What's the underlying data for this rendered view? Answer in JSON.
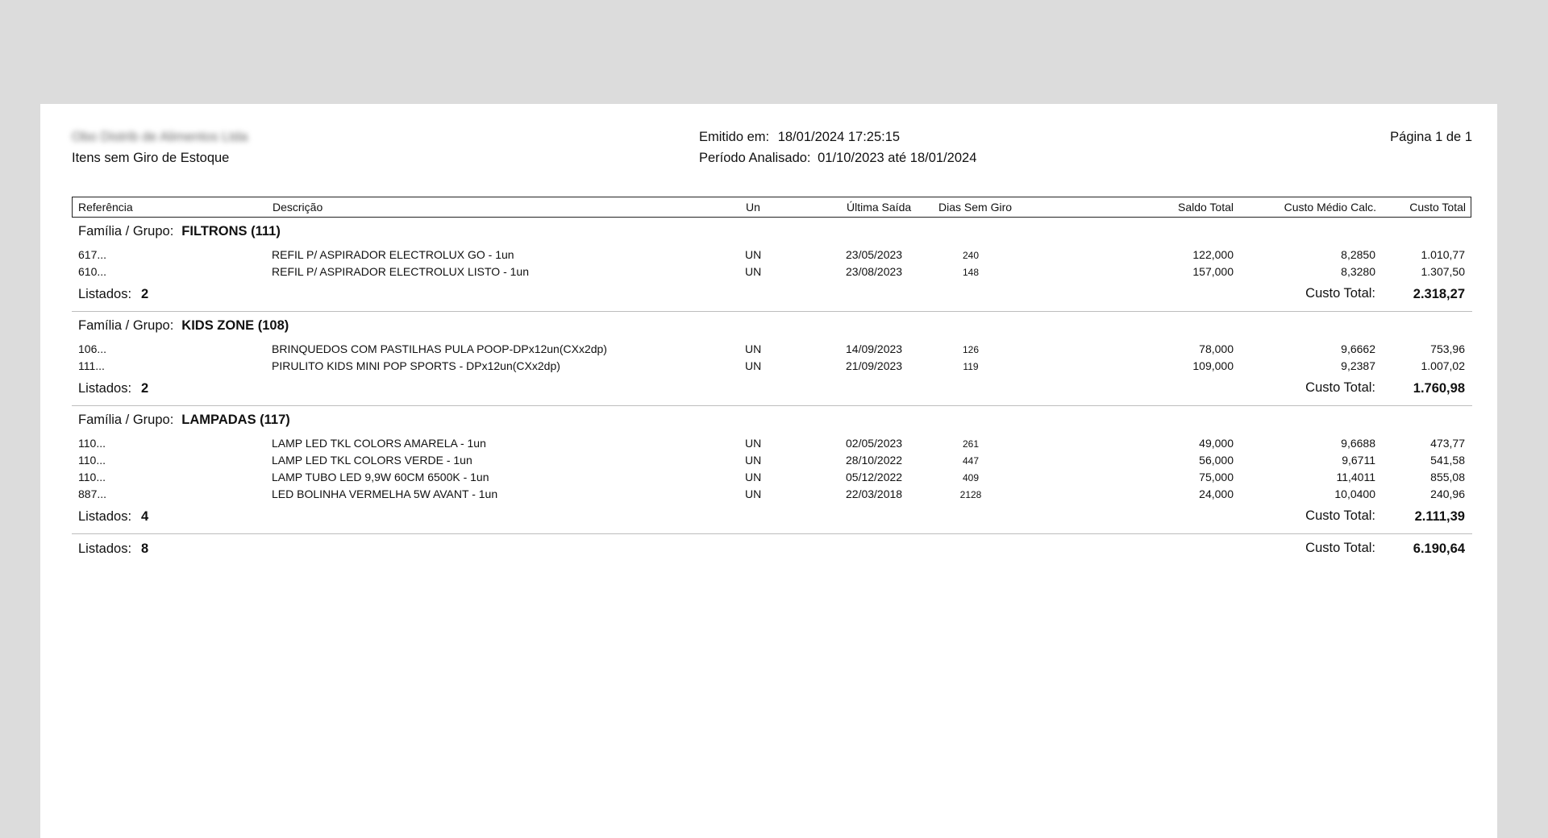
{
  "header": {
    "company": "Obo Distrib de Alimentos Ltda",
    "report_title": "Itens sem Giro de Estoque",
    "emitted_label": "Emitido em:",
    "emitted_value": "18/01/2024 17:25:15",
    "period_label": "Período Analisado:",
    "period_value": "01/10/2023 até 18/01/2024",
    "page": "Página 1 de 1"
  },
  "columns": {
    "ref": "Referência",
    "desc": "Descrição",
    "un": "Un",
    "last": "Última Saída",
    "days": "Dias Sem Giro",
    "saldo": "Saldo Total",
    "cmedio": "Custo Médio Calc.",
    "ctotal": "Custo Total"
  },
  "labels": {
    "group": "Família / Grupo:",
    "listed": "Listados:",
    "total": "Custo Total:"
  },
  "groups": [
    {
      "name": "FILTRONS (111)",
      "rows": [
        {
          "ref": "617...",
          "desc": "REFIL P/ ASPIRADOR ELECTROLUX GO - 1un",
          "un": "UN",
          "last": "23/05/2023",
          "days": "240",
          "saldo": "122,000",
          "cmedio": "8,2850",
          "ctotal": "1.010,77"
        },
        {
          "ref": "610...",
          "desc": "REFIL P/ ASPIRADOR ELECTROLUX LISTO - 1un",
          "un": "UN",
          "last": "23/08/2023",
          "days": "148",
          "saldo": "157,000",
          "cmedio": "8,3280",
          "ctotal": "1.307,50"
        }
      ],
      "listed": "2",
      "total": "2.318,27"
    },
    {
      "name": "KIDS ZONE (108)",
      "rows": [
        {
          "ref": "106...",
          "desc": "BRINQUEDOS COM PASTILHAS PULA POOP-DPx12un(CXx2dp)",
          "un": "UN",
          "last": "14/09/2023",
          "days": "126",
          "saldo": "78,000",
          "cmedio": "9,6662",
          "ctotal": "753,96"
        },
        {
          "ref": "111...",
          "desc": "PIRULITO KIDS MINI POP SPORTS - DPx12un(CXx2dp)",
          "un": "UN",
          "last": "21/09/2023",
          "days": "119",
          "saldo": "109,000",
          "cmedio": "9,2387",
          "ctotal": "1.007,02"
        }
      ],
      "listed": "2",
      "total": "1.760,98"
    },
    {
      "name": "LAMPADAS (117)",
      "rows": [
        {
          "ref": "110...",
          "desc": "LAMP LED TKL COLORS AMARELA - 1un",
          "un": "UN",
          "last": "02/05/2023",
          "days": "261",
          "saldo": "49,000",
          "cmedio": "9,6688",
          "ctotal": "473,77"
        },
        {
          "ref": "110...",
          "desc": "LAMP LED TKL COLORS VERDE - 1un",
          "un": "UN",
          "last": "28/10/2022",
          "days": "447",
          "saldo": "56,000",
          "cmedio": "9,6711",
          "ctotal": "541,58"
        },
        {
          "ref": "110...",
          "desc": "LAMP TUBO LED 9,9W 60CM 6500K - 1un",
          "un": "UN",
          "last": "05/12/2022",
          "days": "409",
          "saldo": "75,000",
          "cmedio": "11,4011",
          "ctotal": "855,08"
        },
        {
          "ref": "887...",
          "desc": "LED BOLINHA VERMELHA 5W AVANT - 1un",
          "un": "UN",
          "last": "22/03/2018",
          "days": "2128",
          "saldo": "24,000",
          "cmedio": "10,0400",
          "ctotal": "240,96"
        }
      ],
      "listed": "4",
      "total": "2.111,39"
    }
  ],
  "grand": {
    "listed": "8",
    "total": "6.190,64"
  }
}
